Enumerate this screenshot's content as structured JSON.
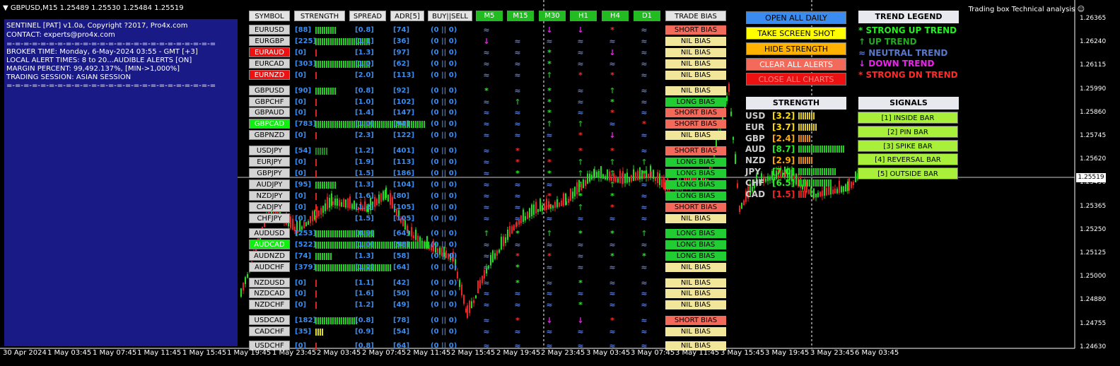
{
  "title": "GBPUSD,M15  1.25489 1.25530 1.25484 1.25519",
  "corner_label": "Trading box Technical analysis",
  "info": [
    "SENTINEL [PAT] v1.0a, Copyright ?2017, Pro4x.com",
    "CONTACT: experts@pro4x.com",
    "=-=-=-=-=-=-=-=-=-=-=-=-=-=-=-=-=-=-=-=-=-=-=-=-=",
    "BROKER TIME: Monday, 6-May-2024 03:55 - GMT [+3]",
    "LOCAL ALERT TIMES: 8 to 20...AUDIBLE ALERTS [ON]",
    "MARGIN PERCENT: 99,492.137%, [MIN->1,000%]",
    "TRADING SESSION: ASIAN SESSION",
    "=-=-=-=-=-=-=-=-=-=-=-=-=-=-=-=-=-=-=-=-=-=-=-=-="
  ],
  "headers": {
    "symbol": "SYMBOL",
    "strength": "STRENGTH",
    "spread": "SPREAD",
    "adr": "ADR[5]",
    "buysell": "BUY||SELL",
    "m5": "M5",
    "m15": "M15",
    "m30": "M30",
    "h1": "H1",
    "h4": "H4",
    "d1": "D1",
    "trade_bias": "TRADE BIAS"
  },
  "trend_symbols": {
    "S": "*",
    "U": "↑",
    "N": "≈",
    "D": "↓"
  },
  "trend_colors": {
    "S": "#ff2a2a",
    "SU": "#22ee22",
    "U": "#22aa22",
    "N": "#5a78c8",
    "D": "#ee22ee"
  },
  "bias_colors": {
    "SHORT BIAS": "#f46a5a",
    "NIL BIAS": "#f2e69a",
    "LONG BIAS": "#22cc33"
  },
  "symbol_colors": {
    "gray": "#d4d4d4",
    "red": "#ee1111",
    "green": "#11ee11"
  },
  "rows": [
    {
      "symbol": "EURUSD",
      "sc": "gray",
      "strength": "[88]",
      "bars": 10,
      "bc": "#22cc22",
      "spread": "[0.8]",
      "adr": "[74]",
      "bs": "(0 || 0)",
      "tf": [
        "N",
        "",
        "D",
        "D",
        "S",
        "N"
      ],
      "bias": "SHORT BIAS"
    },
    {
      "symbol": "EURGBP",
      "sc": "gray",
      "strength": "[225]",
      "bars": 26,
      "bc": "#22cc22",
      "spread": "[1.1]",
      "adr": "[36]",
      "bs": "(0 || 0)",
      "tf": [
        "D",
        "N",
        "N",
        "N",
        "N",
        "N"
      ],
      "bias": "NIL BIAS"
    },
    {
      "symbol": "EURAUD",
      "sc": "red",
      "strength": "[0]",
      "bars": 1,
      "bc": "#dd2222",
      "spread": "[1.3]",
      "adr": "[97]",
      "bs": "(0 || 0)",
      "tf": [
        "N",
        "N",
        "SU",
        "N",
        "D",
        "N"
      ],
      "bias": "NIL BIAS"
    },
    {
      "symbol": "EURCAD",
      "sc": "gray",
      "strength": "[303]",
      "bars": 26,
      "bc": "#22cc22",
      "spread": "[1.0]",
      "adr": "[62]",
      "bs": "(0 || 0)",
      "tf": [
        "N",
        "N",
        "SU",
        "N",
        "N",
        "N"
      ],
      "bias": "NIL BIAS"
    },
    {
      "symbol": "EURNZD",
      "sc": "red",
      "strength": "[0]",
      "bars": 1,
      "bc": "#dd2222",
      "spread": "[2.0]",
      "adr": "[113]",
      "bs": "(0 || 0)",
      "tf": [
        "N",
        "N",
        "U",
        "S",
        "S",
        "N"
      ],
      "bias": "NIL BIAS"
    },
    {
      "symbol": "GBPUSD",
      "sc": "gray",
      "strength": "[90]",
      "bars": 10,
      "bc": "#22cc22",
      "spread": "[0.8]",
      "adr": "[92]",
      "bs": "(0 || 0)",
      "tf": [
        "SU",
        "N",
        "SU",
        "N",
        "U",
        "N"
      ],
      "bias": "NIL BIAS"
    },
    {
      "symbol": "GBPCHF",
      "sc": "gray",
      "strength": "[0]",
      "bars": 1,
      "bc": "#dd2222",
      "spread": "[1.0]",
      "adr": "[102]",
      "bs": "(0 || 0)",
      "tf": [
        "N",
        "U",
        "SU",
        "N",
        "SU",
        "N"
      ],
      "bias": "LONG BIAS"
    },
    {
      "symbol": "GBPAUD",
      "sc": "gray",
      "strength": "[0]",
      "bars": 1,
      "bc": "#dd2222",
      "spread": "[1.4]",
      "adr": "[147]",
      "bs": "(0 || 0)",
      "tf": [
        "N",
        "N",
        "SU",
        "N",
        "S",
        "N"
      ],
      "bias": "SHORT BIAS"
    },
    {
      "symbol": "GBPCAD",
      "sc": "green",
      "strength": "[783]",
      "bars": 52,
      "bc": "#22cc22",
      "spread": "[1.0]",
      "adr": "[94]",
      "bs": "(0 || 0)",
      "tf": [
        "N",
        "N",
        "U",
        "U",
        "N",
        "S"
      ],
      "bias": "SHORT BIAS"
    },
    {
      "symbol": "GBPNZD",
      "sc": "gray",
      "strength": "[0]",
      "bars": 1,
      "bc": "#dd2222",
      "spread": "[2.3]",
      "adr": "[122]",
      "bs": "(0 || 0)",
      "tf": [
        "N",
        "N",
        "N",
        "S",
        "D",
        "N"
      ],
      "bias": "NIL BIAS"
    },
    {
      "symbol": "USDJPY",
      "sc": "gray",
      "strength": "[54]",
      "bars": 6,
      "bc": "#228822",
      "spread": "[1.2]",
      "adr": "[401]",
      "bs": "(0 || 0)",
      "tf": [
        "N",
        "S",
        "SU",
        "S",
        "S",
        "N"
      ],
      "bias": "SHORT BIAS"
    },
    {
      "symbol": "EURJPY",
      "sc": "gray",
      "strength": "[0]",
      "bars": 1,
      "bc": "#dd2222",
      "spread": "[1.9]",
      "adr": "[113]",
      "bs": "(0 || 0)",
      "tf": [
        "N",
        "S",
        "S",
        "U",
        "U",
        "U"
      ],
      "bias": "LONG BIAS"
    },
    {
      "symbol": "GBPJPY",
      "sc": "gray",
      "strength": "[0]",
      "bars": 1,
      "bc": "#dd2222",
      "spread": "[1.5]",
      "adr": "[186]",
      "bs": "(0 || 0)",
      "tf": [
        "N",
        "SU",
        "SU",
        "U",
        "U",
        "SU"
      ],
      "bias": "LONG BIAS"
    },
    {
      "symbol": "AUDJPY",
      "sc": "gray",
      "strength": "[95]",
      "bars": 10,
      "bc": "#22cc22",
      "spread": "[1.3]",
      "adr": "[104]",
      "bs": "(0 || 0)",
      "tf": [
        "N",
        "N",
        "N",
        "U",
        "U",
        "N"
      ],
      "bias": "LONG BIAS"
    },
    {
      "symbol": "NZDJPY",
      "sc": "gray",
      "strength": "[0]",
      "bars": 1,
      "bc": "#dd2222",
      "spread": "[1.6]",
      "adr": "[80]",
      "bs": "(0 || 0)",
      "tf": [
        "N",
        "N",
        "S",
        "SU",
        "SU",
        "N"
      ],
      "bias": "LONG BIAS"
    },
    {
      "symbol": "CADJPY",
      "sc": "gray",
      "strength": "[0]",
      "bars": 1,
      "bc": "#dd2222",
      "spread": "[1.2]",
      "adr": "[105]",
      "bs": "(0 || 0)",
      "tf": [
        "N",
        "N",
        "S",
        "U",
        "S",
        "N"
      ],
      "bias": "SHORT BIAS"
    },
    {
      "symbol": "CHFJPY",
      "sc": "gray",
      "strength": "[0]",
      "bars": 1,
      "bc": "#dd2222",
      "spread": "[1.5]",
      "adr": "[105]",
      "bs": "(0 || 0)",
      "tf": [
        "N",
        "N",
        "N",
        "N",
        "N",
        "N"
      ],
      "bias": "NIL BIAS"
    },
    {
      "symbol": "AUDUSD",
      "sc": "gray",
      "strength": "[253]",
      "bars": 28,
      "bc": "#22cc22",
      "spread": "[0.9]",
      "adr": "[64]",
      "bs": "(0 || 0)",
      "tf": [
        "U",
        "SU",
        "U",
        "SU",
        "SU",
        "U"
      ],
      "bias": "LONG BIAS"
    },
    {
      "symbol": "AUDCAD",
      "sc": "green",
      "strength": "[522]",
      "bars": 54,
      "bc": "#22cc22",
      "spread": "[1.0]",
      "adr": "[58]",
      "bs": "(0 || 0)",
      "tf": [
        "N",
        "N",
        "N",
        "N",
        "N",
        "N"
      ],
      "bias": "LONG BIAS"
    },
    {
      "symbol": "AUDNZD",
      "sc": "gray",
      "strength": "[74]",
      "bars": 8,
      "bc": "#22cc22",
      "spread": "[1.3]",
      "adr": "[58]",
      "bs": "(0 || 0)",
      "tf": [
        "N",
        "S",
        "S",
        "N",
        "SU",
        "SU"
      ],
      "bias": "LONG BIAS"
    },
    {
      "symbol": "AUDCHF",
      "sc": "gray",
      "strength": "[379]",
      "bars": 36,
      "bc": "#22cc22",
      "spread": "[1.2]",
      "adr": "[64]",
      "bs": "(0 || 0)",
      "tf": [
        "N",
        "SU",
        "N",
        "N",
        "N",
        "N"
      ],
      "bias": "NIL BIAS"
    },
    {
      "symbol": "NZDUSD",
      "sc": "gray",
      "strength": "[0]",
      "bars": 1,
      "bc": "#dd2222",
      "spread": "[1.1]",
      "adr": "[42]",
      "bs": "(0 || 0)",
      "tf": [
        "N",
        "SU",
        "N",
        "SU",
        "N",
        "N"
      ],
      "bias": "NIL BIAS"
    },
    {
      "symbol": "NZDCAD",
      "sc": "gray",
      "strength": "[0]",
      "bars": 1,
      "bc": "#dd2222",
      "spread": "[1.6]",
      "adr": "[50]",
      "bs": "(0 || 0)",
      "tf": [
        "N",
        "N",
        "N",
        "N",
        "N",
        "N"
      ],
      "bias": "NIL BIAS"
    },
    {
      "symbol": "NZDCHF",
      "sc": "gray",
      "strength": "[0]",
      "bars": 1,
      "bc": "#dd2222",
      "spread": "[1.2]",
      "adr": "[49]",
      "bs": "(0 || 0)",
      "tf": [
        "N",
        "N",
        "N",
        "SU",
        "N",
        "N"
      ],
      "bias": "NIL BIAS"
    },
    {
      "symbol": "USDCAD",
      "sc": "gray",
      "strength": "[182]",
      "bars": 20,
      "bc": "#22cc22",
      "spread": "[0.8]",
      "adr": "[78]",
      "bs": "(0 || 0)",
      "tf": [
        "N",
        "S",
        "D",
        "D",
        "S",
        "N"
      ],
      "bias": "SHORT BIAS"
    },
    {
      "symbol": "CADCHF",
      "sc": "gray",
      "strength": "[35]",
      "bars": 4,
      "bc": "#dddd22",
      "spread": "[0.9]",
      "adr": "[54]",
      "bs": "(0 || 0)",
      "tf": [
        "N",
        "N",
        "N",
        "N",
        "N",
        "N"
      ],
      "bias": "NIL BIAS"
    },
    {
      "symbol": "USDCHF",
      "sc": "gray",
      "strength": "[0]",
      "bars": 1,
      "bc": "#dd2222",
      "spread": "[0.8]",
      "adr": "[64]",
      "bs": "(0 || 0)",
      "tf": [
        "N",
        "N",
        "N",
        "N",
        "N",
        "N"
      ],
      "bias": "NIL BIAS"
    }
  ],
  "buttons": [
    {
      "label": "OPEN ALL DAILY",
      "bg": "#3a8cf0",
      "fg": "#000000"
    },
    {
      "label": "TAKE SCREEN SHOT",
      "bg": "#ffff00",
      "fg": "#000000"
    },
    {
      "label": "HIDE STRENGTH",
      "bg": "#ffb300",
      "fg": "#000000"
    },
    {
      "label": "CLEAR ALL ALERTS",
      "bg": "#f46a5a",
      "fg": "#ffffff"
    },
    {
      "label": "CLOSE ALL CHARTS",
      "bg": "#ee1111",
      "fg": "#ff8888"
    }
  ],
  "strength_title": "STRENGTH",
  "strength": [
    {
      "cur": "USD",
      "val": "[3.2]",
      "bars": 8,
      "vc": "#ffdd00",
      "bc": "#ddcc33"
    },
    {
      "cur": "EUR",
      "val": "[3.7]",
      "bars": 9,
      "vc": "#ffdd00",
      "bc": "#ddcc33"
    },
    {
      "cur": "GBP",
      "val": "[2.4]",
      "bars": 6,
      "vc": "#ffaa00",
      "bc": "#dd8822"
    },
    {
      "cur": "AUD",
      "val": "[8.7]",
      "bars": 22,
      "vc": "#22ee22",
      "bc": "#22cc22"
    },
    {
      "cur": "NZD",
      "val": "[2.9]",
      "bars": 7,
      "vc": "#ffaa00",
      "bc": "#dd8822"
    },
    {
      "cur": "JPY",
      "val": "[7.0]",
      "bars": 18,
      "vc": "#22ee22",
      "bc": "#22cc22"
    },
    {
      "cur": "CHF",
      "val": "[6.5]",
      "bars": 16,
      "vc": "#22ee22",
      "bc": "#22cc22"
    },
    {
      "cur": "CAD",
      "val": "[1.5]",
      "bars": 4,
      "vc": "#ee2222",
      "bc": "#dd2222"
    }
  ],
  "legend_title": "TREND LEGEND",
  "legend": [
    {
      "sym": "*",
      "label": "STRONG UP TREND",
      "color": "#22ee22"
    },
    {
      "sym": "↑",
      "label": "UP TREND",
      "color": "#22aa22"
    },
    {
      "sym": "≈",
      "label": "NEUTRAL TREND",
      "color": "#5a78c8"
    },
    {
      "sym": "↓",
      "label": "DOWN TREND",
      "color": "#ee22ee"
    },
    {
      "sym": "*",
      "label": "STRONG DN TREND",
      "color": "#ff2a2a"
    }
  ],
  "signals_title": "SIGNALS",
  "signals": [
    "[1] INSIDE BAR",
    "[2] PIN BAR",
    "[3] SPIKE BAR",
    "[4] REVERSAL BAR",
    "[5] OUTSIDE BAR"
  ],
  "price_axis": [
    "1.26365",
    "1.26240",
    "1.26115",
    "1.25990",
    "1.25860",
    "1.25745",
    "1.25620",
    "1.25490",
    "1.25365",
    "1.25250",
    "1.25125",
    "1.25000",
    "1.24880",
    "1.24755",
    "1.24630"
  ],
  "current_price": "1.25519",
  "time_axis": [
    "30 Apr 2024",
    "1 May 03:45",
    "1 May 07:45",
    "1 May 11:45",
    "1 May 15:45",
    "1 May 19:45",
    "1 May 23:45",
    "2 May 03:45",
    "2 May 07:45",
    "2 May 11:45",
    "2 May 15:45",
    "2 May 19:45",
    "2 May 23:45",
    "3 May 03:45",
    "3 May 07:45",
    "3 May 11:45",
    "3 May 15:45",
    "3 May 19:45",
    "3 May 23:45",
    "6 May 03:45"
  ],
  "colors": {
    "bull": "#22dd22",
    "bear": "#ee2222",
    "grid_line": "#cccccc"
  }
}
